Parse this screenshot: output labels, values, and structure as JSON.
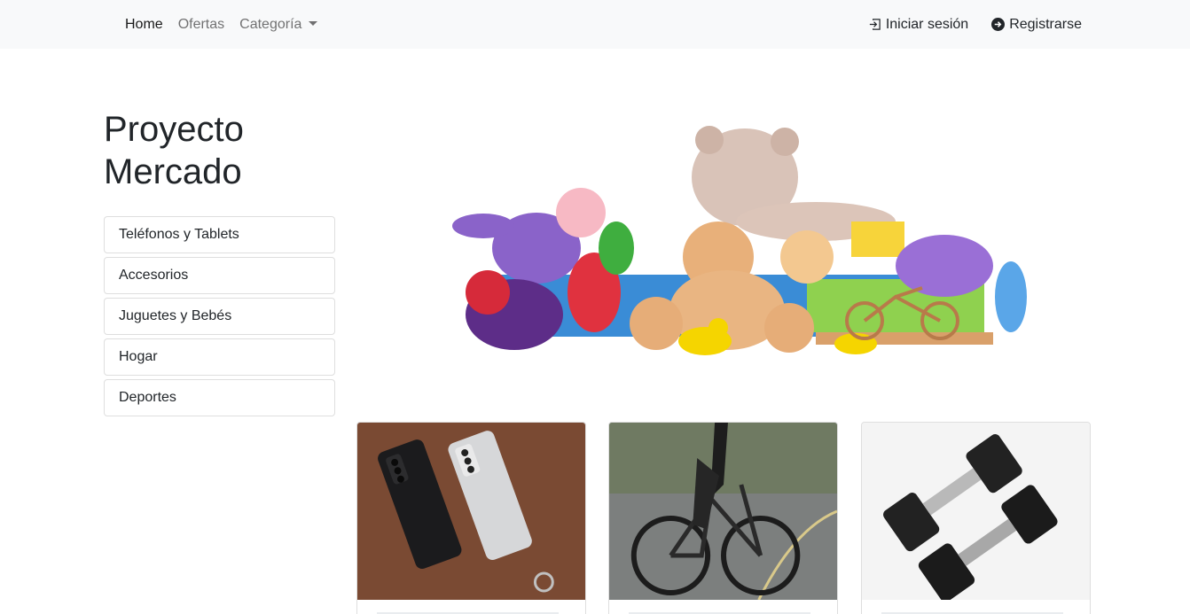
{
  "navbar": {
    "home": "Home",
    "offers": "Ofertas",
    "category": "Categoría",
    "login": "Iniciar sesión",
    "register": "Registrarse"
  },
  "brand": {
    "line1": "Proyecto",
    "line2": "Mercado"
  },
  "categories": [
    "Teléfonos y Tablets",
    "Accesorios",
    "Juguetes y Bebés",
    "Hogar",
    "Deportes"
  ],
  "icons": {
    "login": "login-arrow-icon",
    "register": "arrow-circle-right-icon",
    "dropdown": "caret-down-icon"
  },
  "colors": {
    "navbar_bg": "#f8f9fa",
    "text": "#212529",
    "muted": "#6c757d"
  }
}
